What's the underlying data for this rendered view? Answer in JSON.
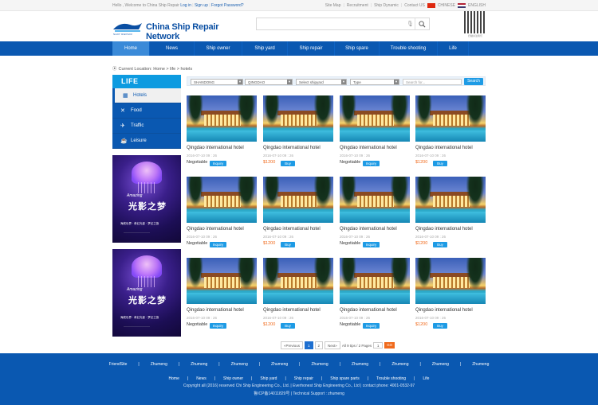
{
  "topbar": {
    "welcome": "Hello , Welcome to China Ship Repair",
    "login": "Log in",
    "signup": "Sign up",
    "forgot": "Forgot Password?",
    "links": [
      "Site Map",
      "Recruitment",
      "Ship Dynamic",
      "Contact US"
    ],
    "chinese": "CHINESE",
    "english": "ENGLISH"
  },
  "logo": {
    "name": "China Ship Repair Network",
    "sub": "SHIP REPAIR"
  },
  "qr_caption": "扫描关注我们",
  "nav": {
    "items": [
      "Home",
      "News",
      "Ship owner",
      "Ship yard",
      "Ship repair",
      "Ship spare",
      "Trouble shooting",
      "Life"
    ]
  },
  "breadcrumb": "Current Location: Home > life > hotels",
  "sidebar": {
    "title": "LIFE",
    "items": [
      {
        "label": "Hotels",
        "icon": "building-icon"
      },
      {
        "label": "Food",
        "icon": "cutlery-icon"
      },
      {
        "label": "Traffic",
        "icon": "plane-icon"
      },
      {
        "label": "Leisure",
        "icon": "coffee-cup-icon"
      }
    ]
  },
  "poster": {
    "line1": "Amazing",
    "line2": "光影之梦",
    "line3": "海底世界 · 奇幻光影 · 梦幻之旅",
    "line4": "———————————"
  },
  "filters": {
    "province": "SHANDONG",
    "city": "QINGDAO",
    "shipyard": "Select shipyard",
    "type": "Type",
    "search_placeholder": "Search for...",
    "search_button": "Search"
  },
  "listings": [
    {
      "title": "Qingdao international hotel",
      "date": "2016-07-10 09 : 26",
      "price": "Negotiable",
      "button": "Inquiry"
    },
    {
      "title": "Qingdao international hotel",
      "date": "2016-07-10 09 : 26",
      "price": "$1200",
      "button": "Buy"
    },
    {
      "title": "Qingdao international hotel",
      "date": "2016-07-10 09 : 26",
      "price": "Negotiable",
      "button": "Inquiry"
    },
    {
      "title": "Qingdao international hotel",
      "date": "2016-07-10 09 : 26",
      "price": "$1200",
      "button": "Buy"
    },
    {
      "title": "Qingdao international hotel",
      "date": "2016-07-10 09 : 26",
      "price": "Negotiable",
      "button": "Inquiry"
    },
    {
      "title": "Qingdao international hotel",
      "date": "2016-07-10 09 : 26",
      "price": "$1200",
      "button": "Buy"
    },
    {
      "title": "Qingdao international hotel",
      "date": "2016-07-10 09 : 26",
      "price": "Negotiable",
      "button": "Inquiry"
    },
    {
      "title": "Qingdao international hotel",
      "date": "2016-07-10 09 : 26",
      "price": "$1200",
      "button": "Buy"
    },
    {
      "title": "Qingdao international hotel",
      "date": "2016-07-10 09 : 26",
      "price": "Negotiable",
      "button": "Inquiry"
    },
    {
      "title": "Qingdao international hotel",
      "date": "2016-07-10 09 : 26",
      "price": "$1200",
      "button": "Buy"
    },
    {
      "title": "Qingdao international hotel",
      "date": "2016-07-10 09 : 26",
      "price": "Negotiable",
      "button": "Inquiry"
    },
    {
      "title": "Qingdao international hotel",
      "date": "2016-07-10 09 : 26",
      "price": "$1200",
      "button": "Buy"
    }
  ],
  "pager": {
    "prev": "«Previous",
    "pages": [
      "1",
      "2"
    ],
    "next": "Next»",
    "info": "All 9 tips / 2 Pages",
    "input": "1",
    "go": "GO"
  },
  "footer": {
    "friend": [
      "FriendSite",
      "Zhumeng",
      "Zhumeng",
      "Zhumeng",
      "Zhumeng",
      "Zhumeng",
      "Zhumeng",
      "Zhumeng",
      "Zhumeng",
      "Zhumeng"
    ],
    "nav": [
      "Home",
      "News",
      "Ship owner",
      "Ship yard",
      "Ship repair",
      "Ship spare parts",
      "Trouble shooting",
      "Life"
    ],
    "copyright": "Copyright all (2016) reserved Chi Ship Engineering Co., Ltd. | Everhonest Ship Engineering Co., Ltd | contact phone: 4001-0532-97",
    "icp": "鲁ICP备14011829号 | Technical Support : zhumeng"
  },
  "colors": {
    "brand_blue": "#0a58b1",
    "accent_blue": "#1e9be5",
    "price_orange": "#f06a1c"
  }
}
